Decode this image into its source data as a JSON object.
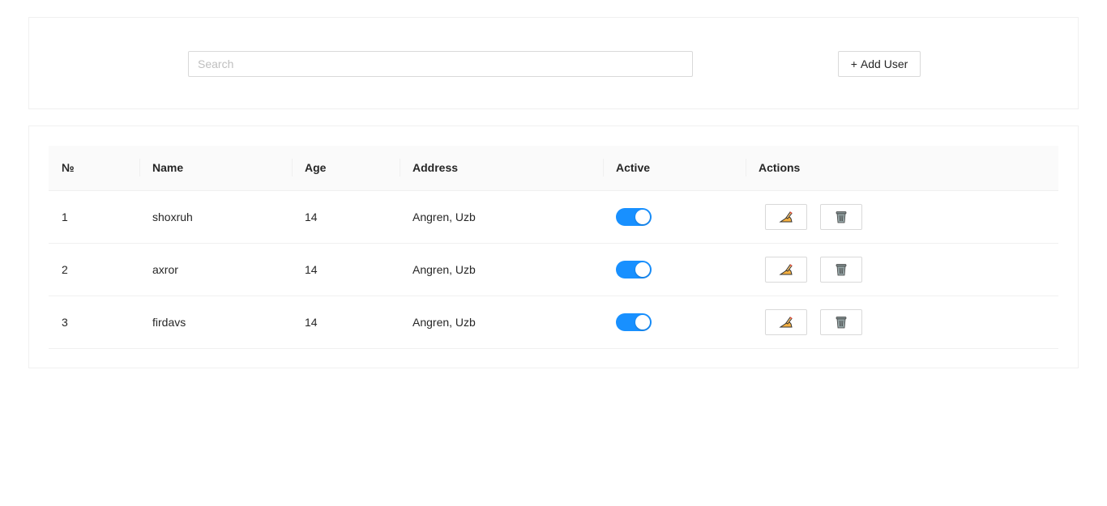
{
  "toolbar": {
    "search_placeholder": "Search",
    "add_user_label": "Add User",
    "add_user_icon": "plus-icon"
  },
  "table": {
    "columns": [
      "№",
      "Name",
      "Age",
      "Address",
      "Active",
      "Actions"
    ],
    "rows": [
      {
        "no": "1",
        "name": "shoxruh",
        "age": "14",
        "address": "Angren, Uzb",
        "active": true
      },
      {
        "no": "2",
        "name": "axror",
        "age": "14",
        "address": "Angren, Uzb",
        "active": true
      },
      {
        "no": "3",
        "name": "firdavs",
        "age": "14",
        "address": "Angren, Uzb",
        "active": true
      }
    ],
    "action_icons": [
      "edit-pencil-icon",
      "trash-icon"
    ]
  },
  "colors": {
    "accent": "#1890ff",
    "border": "#d9d9d9",
    "header_bg": "#fafafa"
  }
}
